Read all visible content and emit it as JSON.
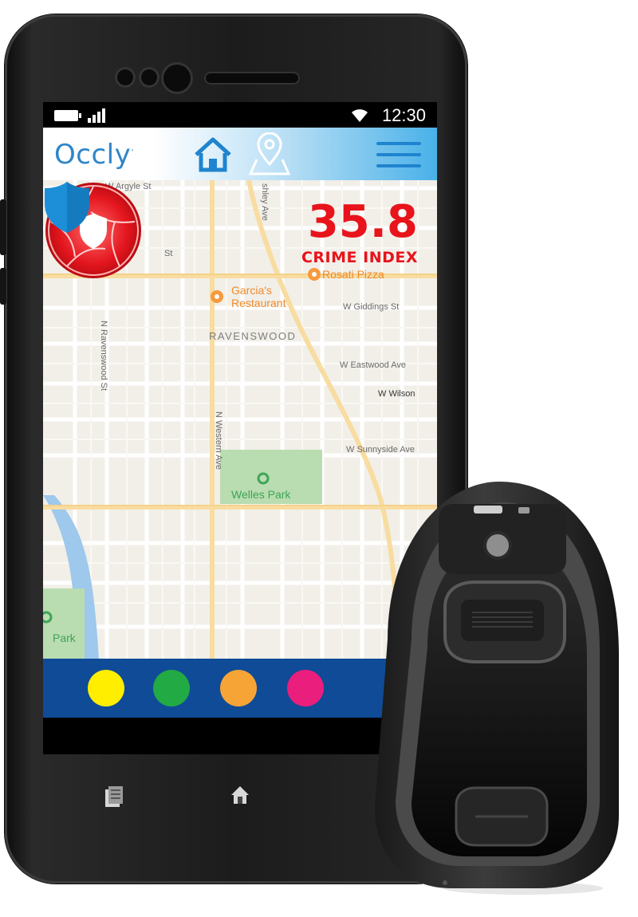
{
  "status_bar": {
    "time": "12:30"
  },
  "app_bar": {
    "logo": "Occly",
    "logo_mark": "·"
  },
  "map": {
    "crime_index": {
      "value": "35.8",
      "label": "CRIME INDEX"
    },
    "streets": {
      "argyle": "W Argyle St",
      "ashley": "shley Ave",
      "giddings": "W Giddings St",
      "eastwood": "W Eastwood Ave",
      "wilson": "W Wilson",
      "sunnyside": "W Sunnyside Ave",
      "western": "N Western Ave",
      "ravenswood_st": "N Ravenswood St",
      "st": "St"
    },
    "neighborhood": "RAVENSWOOD",
    "pois": {
      "pizza": "Rosati Pizza",
      "restaurant_1": "Garcia's",
      "restaurant_2": "Restaurant"
    },
    "parks": {
      "welles": "Welles Park",
      "park": "Park"
    }
  },
  "color_dots": [
    {
      "name": "yellow",
      "color": "#ffee00"
    },
    {
      "name": "green",
      "color": "#22aa44"
    },
    {
      "name": "orange",
      "color": "#f7a436"
    },
    {
      "name": "pink",
      "color": "#ea1e7c"
    }
  ],
  "colors": {
    "accent_blue": "#1f84cf",
    "crime_red": "#e8131b",
    "bar_blue": "#0f4b97"
  },
  "icons": [
    "battery-icon",
    "signal-icon",
    "wifi-icon",
    "home-icon",
    "location-pin-icon",
    "menu-icon",
    "shutter-shield-icon",
    "shield-pin-icon",
    "recent-apps-icon",
    "home-soft-icon"
  ]
}
